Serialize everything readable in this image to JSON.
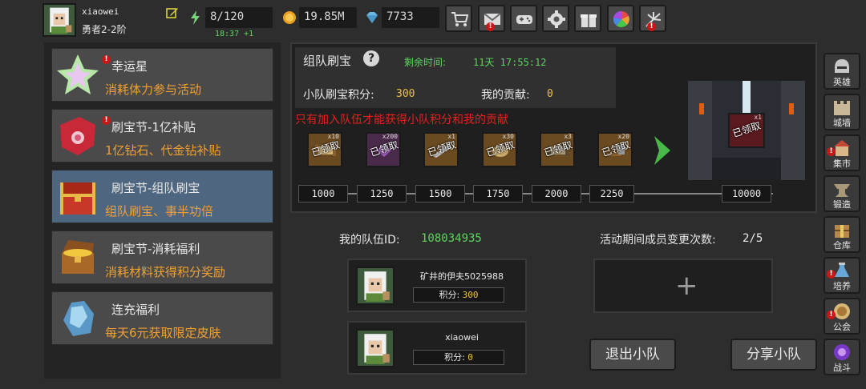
{
  "user": {
    "name": "xiaowei",
    "rank": "勇者2-2阶"
  },
  "resources": {
    "energy": "8/120",
    "energy_timer": "18:37 +1",
    "gold": "19.85M",
    "gems": "7733"
  },
  "top_buttons": [
    "shop-cart-icon",
    "mail-icon",
    "gamepad-icon",
    "gear-icon",
    "gift-icon",
    "color-wheel-icon",
    "firework-icon"
  ],
  "activities": [
    {
      "title": "幸运星",
      "desc": "消耗体力参与活动",
      "icon": "star-crystal-icon",
      "badge": "!"
    },
    {
      "title": "刷宝节-1亿补贴",
      "desc": "1亿钻石、代金钻补贴",
      "icon": "red-flower-icon",
      "badge": "!"
    },
    {
      "title": "刷宝节-组队刷宝",
      "desc": "组队刷宝、事半功倍",
      "icon": "red-chest-icon",
      "badge": ""
    },
    {
      "title": "刷宝节-消耗福利",
      "desc": "消耗材料获得积分奖励",
      "icon": "gold-chest-icon",
      "badge": ""
    },
    {
      "title": "连充福利",
      "desc": "每天6元获取限定皮肤",
      "icon": "ice-crystal-icon",
      "badge": ""
    }
  ],
  "panel": {
    "title": "组队刷宝",
    "help": "?",
    "remaining_label": "剩余时间:",
    "remaining_value": "11天 17:55:12",
    "team_score_label": "小队刷宝积分:",
    "team_score": "300",
    "contribution_label": "我的贡献:",
    "contribution": "0",
    "warning": "只有加入队伍才能获得小队积分和我的贡献",
    "claimed_text": "已领取",
    "rewards": [
      {
        "count": "x10",
        "item": "scroll"
      },
      {
        "count": "x200",
        "item": "gem-shard"
      },
      {
        "count": "x1",
        "item": "sword"
      },
      {
        "count": "x30",
        "item": "potion"
      },
      {
        "count": "x3",
        "item": "scroll"
      },
      {
        "count": "x20",
        "item": "hammer"
      }
    ],
    "milestones": [
      "1000",
      "1250",
      "1500",
      "1750",
      "2000",
      "2250"
    ],
    "final_milestone": "10000",
    "final_reward_count": "x1",
    "final_reward_claimed": "已领取"
  },
  "team": {
    "id_label": "我的队伍ID:",
    "id_value": "108034935",
    "changes_label": "活动期间成员变更次数:",
    "changes_value": "2/5",
    "score_label": "积分:",
    "members": [
      {
        "name": "矿井的伊夫5025988",
        "score": "300"
      },
      {
        "name": "xiaowei",
        "score": "0"
      }
    ],
    "add_symbol": "+",
    "leave_button": "退出小队",
    "share_button": "分享小队"
  },
  "sidebar": [
    {
      "label": "英雄",
      "icon": "helmet-icon",
      "badge": ""
    },
    {
      "label": "城墙",
      "icon": "castle-wall-icon",
      "badge": ""
    },
    {
      "label": "集市",
      "icon": "market-icon",
      "badge": "!"
    },
    {
      "label": "锻造",
      "icon": "anvil-icon",
      "badge": ""
    },
    {
      "label": "仓库",
      "icon": "warehouse-icon",
      "badge": ""
    },
    {
      "label": "培养",
      "icon": "flask-icon",
      "badge": "!"
    },
    {
      "label": "公会",
      "icon": "guild-icon",
      "badge": "!"
    },
    {
      "label": "战斗",
      "icon": "portal-icon",
      "badge": ""
    }
  ],
  "colors": {
    "accent_green": "#5cd65c",
    "accent_orange": "#f0a030",
    "warning_red": "#e82020",
    "selected_row": "#4f6680"
  }
}
